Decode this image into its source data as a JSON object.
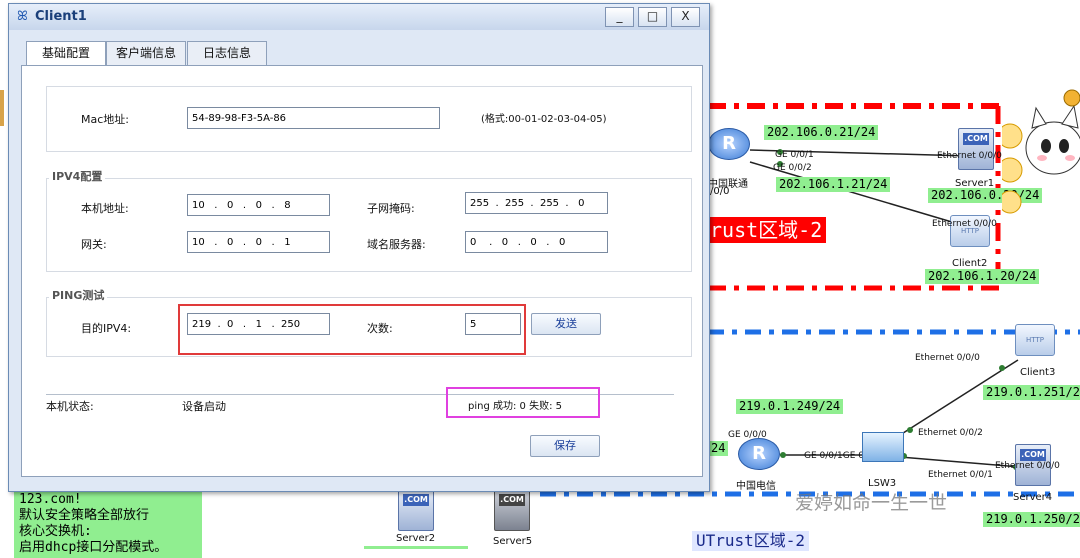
{
  "window": {
    "title": "Client1",
    "controls": {
      "minimize": "_",
      "maximize": "□",
      "close": "X"
    }
  },
  "tabs": [
    {
      "label": "基础配置",
      "active": true
    },
    {
      "label": "客户端信息"
    },
    {
      "label": "日志信息"
    }
  ],
  "mac": {
    "label": "Mac地址:",
    "value": "54-89-98-F3-5A-86",
    "hint": "(格式:00-01-02-03-04-05)"
  },
  "ipv4": {
    "group_title": "IPV4配置",
    "host_label": "本机地址:",
    "host_value": "10   .   0   .   0   .   8",
    "mask_label": "子网掩码:",
    "mask_value": "255  .  255  .  255  .   0",
    "gateway_label": "网关:",
    "gateway_value": "10   .   0   .   0   .   1",
    "dns_label": "域名服务器:",
    "dns_value": "0    .   0   .   0   .   0"
  },
  "ping": {
    "group_title": "PING测试",
    "dest_label": "目的IPV4:",
    "dest_value": "219  .  0   .   1   .  250",
    "count_label": "次数:",
    "count_value": "5",
    "send_button": "发送"
  },
  "status": {
    "label": "本机状态:",
    "value": "设备启动",
    "ping_result": "ping 成功: 0    失败: 5"
  },
  "save_button": "保存",
  "topology": {
    "ip_labels": {
      "r1_ge001": "202.106.0.21/24",
      "r1_ge002": "202.106.1.21/24",
      "server1": "202.106.0.20/24",
      "client2": "202.106.1.20/24",
      "r2_ge000": "219.0.1.249/24",
      "client3": "219.0.1.251/24",
      "server4": "219.0.1.250/24",
      "partial": "24"
    },
    "interfaces": {
      "ge001": "GE 0/0/1",
      "ge002": "GE 0/0/2",
      "eth_server1": "Ethernet 0/0/0",
      "eth_client2": "Ethernet 0/0/0",
      "eth_lsw_top": "Ethernet 0/0/0",
      "ge000": "GE 0/0/0",
      "ge001_pair": "GE 0/0/1GE 0/0/1",
      "eth002": "Ethernet 0/0/2",
      "eth001": "Ethernet 0/0/1",
      "eth_server4": "Ethernet 0/0/0",
      "r1_if_partial": "/0/0"
    },
    "devices": {
      "r1_name": "中国联通",
      "server1": "Server1",
      "client2": "Client2",
      "client3": "Client3",
      "r2_name": "中国电信",
      "lsw3": "LSW3",
      "server4": "Server4",
      "server2": "Server2",
      "server5": "Server5"
    },
    "zones": {
      "trust2": "rust区域-2",
      "untrust2": "UTrust区域-2"
    },
    "note_lines": [
      "123.com!",
      "默认安全策略全部放行",
      "核心交换机:",
      "启用dhcp接口分配模式。"
    ],
    "watermark": "爱婷如命一生一世",
    "colors": {
      "red_zone": "#ff0000",
      "blue_zone": "#1e6fe6",
      "ip_label_bg": "#90ee90",
      "link": "#2e7d32"
    }
  }
}
